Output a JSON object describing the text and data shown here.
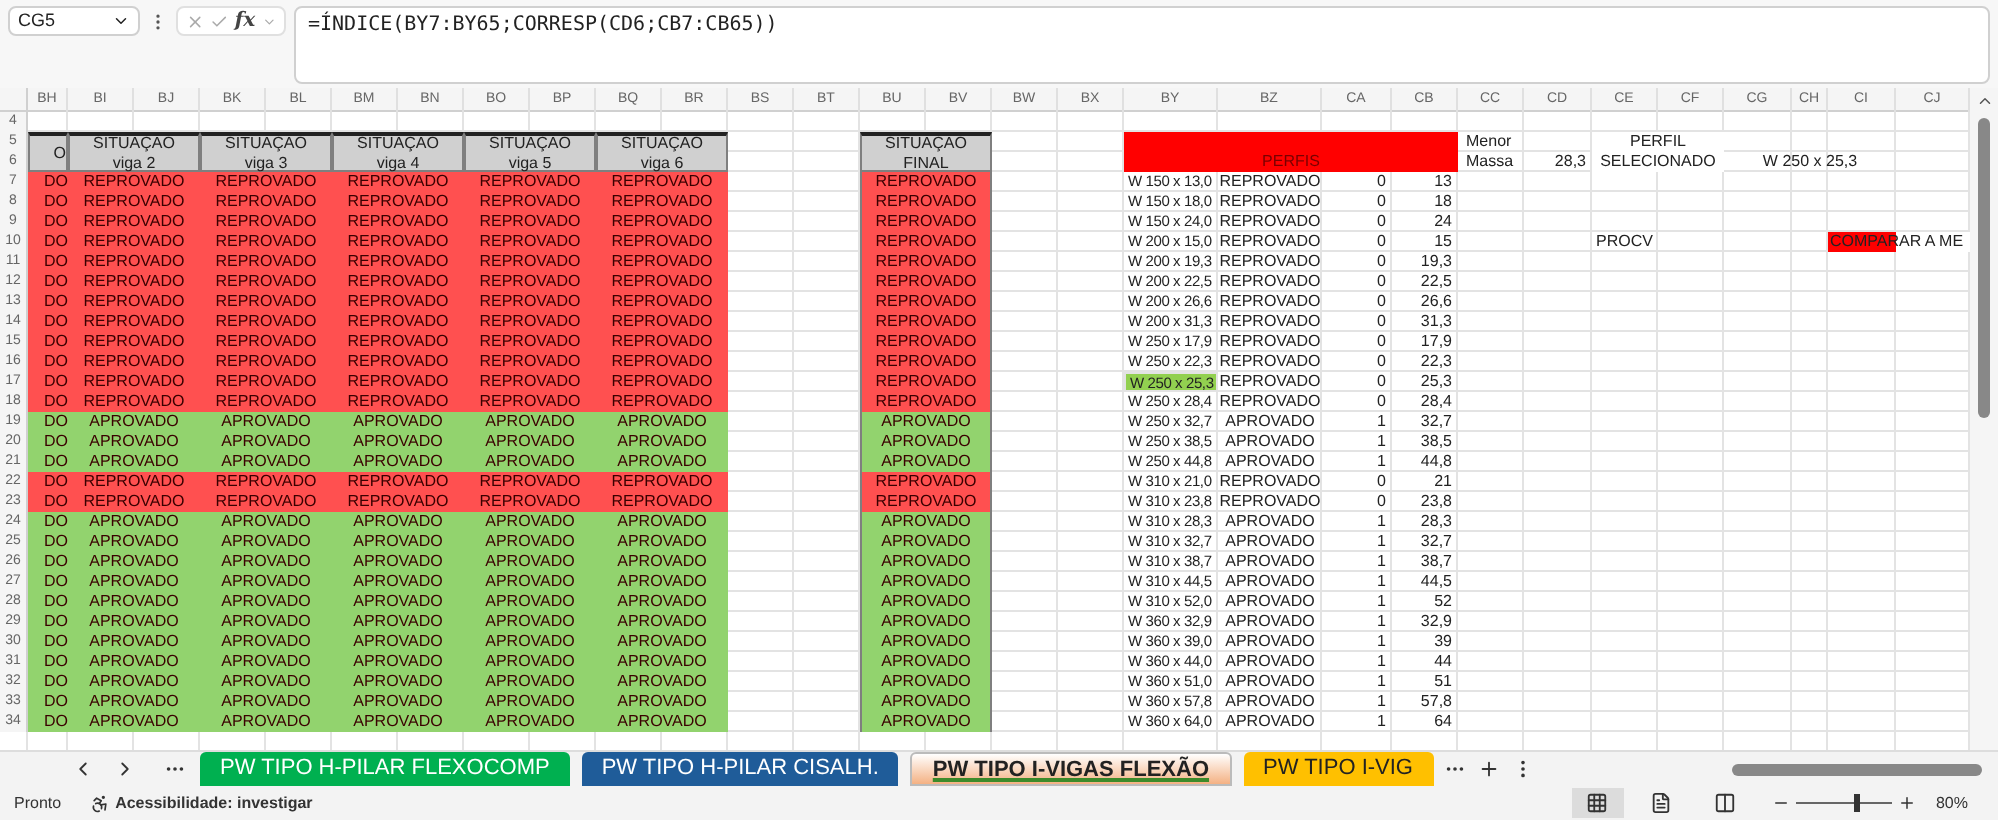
{
  "formula_bar": {
    "name_box": "CG5",
    "function_label": "fx",
    "formula": "=ÍNDICE(BY7:BY65;CORRESP(CD6;CB7:CB65))"
  },
  "column_letters": [
    "BH",
    "BI",
    "BJ",
    "BK",
    "BL",
    "BM",
    "BN",
    "BO",
    "BP",
    "BQ",
    "BR",
    "BS",
    "BT",
    "BU",
    "BV",
    "BW",
    "BX",
    "BY",
    "BZ",
    "CA",
    "CB",
    "CC",
    "CD",
    "CE",
    "CF",
    "CG",
    "CH",
    "CI",
    "CJ"
  ],
  "header_rows": [
    "4",
    "5",
    "6"
  ],
  "left_table": {
    "column_1_header": "O",
    "beam_headers": [
      {
        "title": "SITUAÇÃO",
        "subtitle": "viga 2"
      },
      {
        "title": "SITUAÇÃO",
        "subtitle": "viga 3"
      },
      {
        "title": "SITUAÇÃO",
        "subtitle": "viga 4"
      },
      {
        "title": "SITUAÇÃO",
        "subtitle": "viga 5"
      },
      {
        "title": "SITUAÇÃO",
        "subtitle": "viga 6"
      }
    ],
    "final_header": {
      "title": "SITUAÇÃO",
      "subtitle": "FINAL"
    }
  },
  "profiles_panel": {
    "title": "PERFIS",
    "min_label_1": "Menor",
    "min_label_2": "Massa",
    "min_value": "28,3",
    "selected_label": {
      "title": "PERFIL",
      "subtitle": "SELECIONADO"
    },
    "selected_value": "W 250 x 25,3",
    "lookup_label": "PROCV",
    "compare_label": "COMPARAR A ME"
  },
  "rows": [
    {
      "number": "7",
      "column_1": "DO",
      "beams": [
        "REPROVADO",
        "REPROVADO",
        "REPROVADO",
        "REPROVADO",
        "REPROVADO"
      ],
      "final": "REPROVADO",
      "passed": false,
      "profile": "W 150 x 13,0",
      "result": "REPROVADO",
      "flag": "0",
      "mass": "13",
      "highlighted": false
    },
    {
      "number": "8",
      "column_1": "DO",
      "beams": [
        "REPROVADO",
        "REPROVADO",
        "REPROVADO",
        "REPROVADO",
        "REPROVADO"
      ],
      "final": "REPROVADO",
      "passed": false,
      "profile": "W 150 x 18,0",
      "result": "REPROVADO",
      "flag": "0",
      "mass": "18",
      "highlighted": false
    },
    {
      "number": "9",
      "column_1": "DO",
      "beams": [
        "REPROVADO",
        "REPROVADO",
        "REPROVADO",
        "REPROVADO",
        "REPROVADO"
      ],
      "final": "REPROVADO",
      "passed": false,
      "profile": "W 150 x 24,0",
      "result": "REPROVADO",
      "flag": "0",
      "mass": "24",
      "highlighted": false
    },
    {
      "number": "10",
      "column_1": "DO",
      "beams": [
        "REPROVADO",
        "REPROVADO",
        "REPROVADO",
        "REPROVADO",
        "REPROVADO"
      ],
      "final": "REPROVADO",
      "passed": false,
      "profile": "W 200 x 15,0",
      "result": "REPROVADO",
      "flag": "0",
      "mass": "15",
      "highlighted": false
    },
    {
      "number": "11",
      "column_1": "DO",
      "beams": [
        "REPROVADO",
        "REPROVADO",
        "REPROVADO",
        "REPROVADO",
        "REPROVADO"
      ],
      "final": "REPROVADO",
      "passed": false,
      "profile": "W 200 x 19,3",
      "result": "REPROVADO",
      "flag": "0",
      "mass": "19,3",
      "highlighted": false
    },
    {
      "number": "12",
      "column_1": "DO",
      "beams": [
        "REPROVADO",
        "REPROVADO",
        "REPROVADO",
        "REPROVADO",
        "REPROVADO"
      ],
      "final": "REPROVADO",
      "passed": false,
      "profile": "W 200 x 22,5",
      "result": "REPROVADO",
      "flag": "0",
      "mass": "22,5",
      "highlighted": false
    },
    {
      "number": "13",
      "column_1": "DO",
      "beams": [
        "REPROVADO",
        "REPROVADO",
        "REPROVADO",
        "REPROVADO",
        "REPROVADO"
      ],
      "final": "REPROVADO",
      "passed": false,
      "profile": "W 200 x 26,6",
      "result": "REPROVADO",
      "flag": "0",
      "mass": "26,6",
      "highlighted": false
    },
    {
      "number": "14",
      "column_1": "DO",
      "beams": [
        "REPROVADO",
        "REPROVADO",
        "REPROVADO",
        "REPROVADO",
        "REPROVADO"
      ],
      "final": "REPROVADO",
      "passed": false,
      "profile": "W 200 x 31,3",
      "result": "REPROVADO",
      "flag": "0",
      "mass": "31,3",
      "highlighted": false
    },
    {
      "number": "15",
      "column_1": "DO",
      "beams": [
        "REPROVADO",
        "REPROVADO",
        "REPROVADO",
        "REPROVADO",
        "REPROVADO"
      ],
      "final": "REPROVADO",
      "passed": false,
      "profile": "W 250 x 17,9",
      "result": "REPROVADO",
      "flag": "0",
      "mass": "17,9",
      "highlighted": false
    },
    {
      "number": "16",
      "column_1": "DO",
      "beams": [
        "REPROVADO",
        "REPROVADO",
        "REPROVADO",
        "REPROVADO",
        "REPROVADO"
      ],
      "final": "REPROVADO",
      "passed": false,
      "profile": "W 250 x 22,3",
      "result": "REPROVADO",
      "flag": "0",
      "mass": "22,3",
      "highlighted": false
    },
    {
      "number": "17",
      "column_1": "DO",
      "beams": [
        "REPROVADO",
        "REPROVADO",
        "REPROVADO",
        "REPROVADO",
        "REPROVADO"
      ],
      "final": "REPROVADO",
      "passed": false,
      "profile": "W 250 x 25,3",
      "result": "REPROVADO",
      "flag": "0",
      "mass": "25,3",
      "highlighted": true
    },
    {
      "number": "18",
      "column_1": "DO",
      "beams": [
        "REPROVADO",
        "REPROVADO",
        "REPROVADO",
        "REPROVADO",
        "REPROVADO"
      ],
      "final": "REPROVADO",
      "passed": false,
      "profile": "W 250 x 28,4",
      "result": "REPROVADO",
      "flag": "0",
      "mass": "28,4",
      "highlighted": false
    },
    {
      "number": "19",
      "column_1": "DO",
      "beams": [
        "APROVADO",
        "APROVADO",
        "APROVADO",
        "APROVADO",
        "APROVADO"
      ],
      "final": "APROVADO",
      "passed": true,
      "profile": "W 250 x 32,7",
      "result": "APROVADO",
      "flag": "1",
      "mass": "32,7",
      "highlighted": false
    },
    {
      "number": "20",
      "column_1": "DO",
      "beams": [
        "APROVADO",
        "APROVADO",
        "APROVADO",
        "APROVADO",
        "APROVADO"
      ],
      "final": "APROVADO",
      "passed": true,
      "profile": "W 250 x 38,5",
      "result": "APROVADO",
      "flag": "1",
      "mass": "38,5",
      "highlighted": false
    },
    {
      "number": "21",
      "column_1": "DO",
      "beams": [
        "APROVADO",
        "APROVADO",
        "APROVADO",
        "APROVADO",
        "APROVADO"
      ],
      "final": "APROVADO",
      "passed": true,
      "profile": "W 250 x 44,8",
      "result": "APROVADO",
      "flag": "1",
      "mass": "44,8",
      "highlighted": false
    },
    {
      "number": "22",
      "column_1": "DO",
      "beams": [
        "REPROVADO",
        "REPROVADO",
        "REPROVADO",
        "REPROVADO",
        "REPROVADO"
      ],
      "final": "REPROVADO",
      "passed": false,
      "profile": "W 310 x 21,0",
      "result": "REPROVADO",
      "flag": "0",
      "mass": "21",
      "highlighted": false
    },
    {
      "number": "23",
      "column_1": "DO",
      "beams": [
        "REPROVADO",
        "REPROVADO",
        "REPROVADO",
        "REPROVADO",
        "REPROVADO"
      ],
      "final": "REPROVADO",
      "passed": false,
      "profile": "W 310 x 23,8",
      "result": "REPROVADO",
      "flag": "0",
      "mass": "23,8",
      "highlighted": false
    },
    {
      "number": "24",
      "column_1": "DO",
      "beams": [
        "APROVADO",
        "APROVADO",
        "APROVADO",
        "APROVADO",
        "APROVADO"
      ],
      "final": "APROVADO",
      "passed": true,
      "profile": "W 310 x 28,3",
      "result": "APROVADO",
      "flag": "1",
      "mass": "28,3",
      "highlighted": false
    },
    {
      "number": "25",
      "column_1": "DO",
      "beams": [
        "APROVADO",
        "APROVADO",
        "APROVADO",
        "APROVADO",
        "APROVADO"
      ],
      "final": "APROVADO",
      "passed": true,
      "profile": "W 310 x 32,7",
      "result": "APROVADO",
      "flag": "1",
      "mass": "32,7",
      "highlighted": false
    },
    {
      "number": "26",
      "column_1": "DO",
      "beams": [
        "APROVADO",
        "APROVADO",
        "APROVADO",
        "APROVADO",
        "APROVADO"
      ],
      "final": "APROVADO",
      "passed": true,
      "profile": "W 310 x 38,7",
      "result": "APROVADO",
      "flag": "1",
      "mass": "38,7",
      "highlighted": false
    },
    {
      "number": "27",
      "column_1": "DO",
      "beams": [
        "APROVADO",
        "APROVADO",
        "APROVADO",
        "APROVADO",
        "APROVADO"
      ],
      "final": "APROVADO",
      "passed": true,
      "profile": "W 310 x 44,5",
      "result": "APROVADO",
      "flag": "1",
      "mass": "44,5",
      "highlighted": false
    },
    {
      "number": "28",
      "column_1": "DO",
      "beams": [
        "APROVADO",
        "APROVADO",
        "APROVADO",
        "APROVADO",
        "APROVADO"
      ],
      "final": "APROVADO",
      "passed": true,
      "profile": "W 310 x 52,0",
      "result": "APROVADO",
      "flag": "1",
      "mass": "52",
      "highlighted": false
    },
    {
      "number": "29",
      "column_1": "DO",
      "beams": [
        "APROVADO",
        "APROVADO",
        "APROVADO",
        "APROVADO",
        "APROVADO"
      ],
      "final": "APROVADO",
      "passed": true,
      "profile": "W 360 x 32,9",
      "result": "APROVADO",
      "flag": "1",
      "mass": "32,9",
      "highlighted": false
    },
    {
      "number": "30",
      "column_1": "DO",
      "beams": [
        "APROVADO",
        "APROVADO",
        "APROVADO",
        "APROVADO",
        "APROVADO"
      ],
      "final": "APROVADO",
      "passed": true,
      "profile": "W 360 x 39,0",
      "result": "APROVADO",
      "flag": "1",
      "mass": "39",
      "highlighted": false
    },
    {
      "number": "31",
      "column_1": "DO",
      "beams": [
        "APROVADO",
        "APROVADO",
        "APROVADO",
        "APROVADO",
        "APROVADO"
      ],
      "final": "APROVADO",
      "passed": true,
      "profile": "W 360 x 44,0",
      "result": "APROVADO",
      "flag": "1",
      "mass": "44",
      "highlighted": false
    },
    {
      "number": "32",
      "column_1": "DO",
      "beams": [
        "APROVADO",
        "APROVADO",
        "APROVADO",
        "APROVADO",
        "APROVADO"
      ],
      "final": "APROVADO",
      "passed": true,
      "profile": "W 360 x 51,0",
      "result": "APROVADO",
      "flag": "1",
      "mass": "51",
      "highlighted": false
    },
    {
      "number": "33",
      "column_1": "DO",
      "beams": [
        "APROVADO",
        "APROVADO",
        "APROVADO",
        "APROVADO",
        "APROVADO"
      ],
      "final": "APROVADO",
      "passed": true,
      "profile": "W 360 x 57,8",
      "result": "APROVADO",
      "flag": "1",
      "mass": "57,8",
      "highlighted": false
    },
    {
      "number": "34",
      "column_1": "DO",
      "beams": [
        "APROVADO",
        "APROVADO",
        "APROVADO",
        "APROVADO",
        "APROVADO"
      ],
      "final": "APROVADO",
      "passed": true,
      "profile": "W 360 x 64,0",
      "result": "APROVADO",
      "flag": "1",
      "mass": "64",
      "highlighted": false
    }
  ],
  "sheet_tabs": [
    {
      "label": "PW TIPO H-PILAR FLEXOCOMP",
      "color": "#00b050",
      "selected": false
    },
    {
      "label": "PW TIPO H-PILAR CISALH.",
      "color": "#1f5c99",
      "selected": false
    },
    {
      "label": "PW TIPO I-VIGAS FLEXÃO",
      "color": "#f4b183",
      "selected": true
    },
    {
      "label": "PW TIPO I-VIG",
      "color": "#ffc000",
      "selected": false
    }
  ],
  "status_bar": {
    "status": "Pronto",
    "accessibility": "Acessibilidade: investigar",
    "views": [
      {
        "kind": "normal",
        "selected": true
      },
      {
        "kind": "layout",
        "selected": false
      },
      {
        "kind": "break",
        "selected": false
      }
    ],
    "zoom": {
      "level": 0.62,
      "reading": "80%"
    }
  }
}
